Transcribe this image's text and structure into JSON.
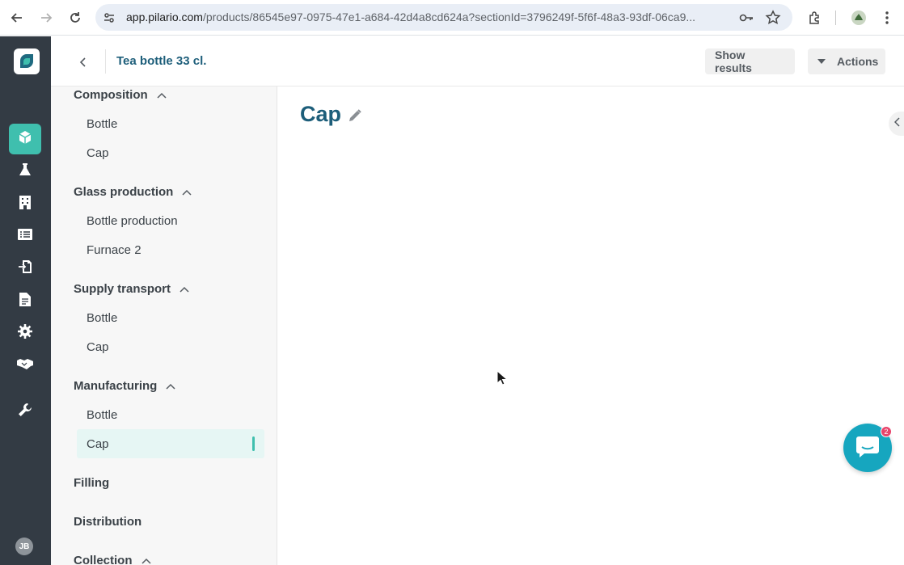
{
  "browser": {
    "url_host": "app.pilario.com",
    "url_rest": "/products/86545e97-0975-47e1-a684-42d4a8cd624a?sectionId=3796249f-5f6f-48a3-93df-06ca9..."
  },
  "rail": {
    "avatar_initials": "JB",
    "items": [
      "product-icon",
      "flask-icon",
      "building-icon",
      "list-icon",
      "import-icon",
      "document-icon",
      "gear-icon",
      "handshake-icon",
      "wrench-icon"
    ],
    "accent": "#3fbfae"
  },
  "header": {
    "title": "Tea bottle 33 cl.",
    "show_results": "Show results",
    "actions": "Actions"
  },
  "sidebar": {
    "sections": [
      {
        "label": "Composition",
        "items": [
          "Bottle",
          "Cap"
        ]
      },
      {
        "label": "Glass production",
        "items": [
          "Bottle production",
          "Furnace 2"
        ]
      },
      {
        "label": "Supply transport",
        "items": [
          "Bottle",
          "Cap"
        ]
      },
      {
        "label": "Manufacturing",
        "items": [
          "Bottle",
          "Cap"
        ]
      },
      {
        "label": "Filling",
        "items": []
      },
      {
        "label": "Distribution",
        "items": []
      },
      {
        "label": "Collection",
        "items": []
      }
    ],
    "selected": "Manufacturing / Cap"
  },
  "main": {
    "title": "Cap"
  },
  "chat": {
    "badge": "2"
  }
}
